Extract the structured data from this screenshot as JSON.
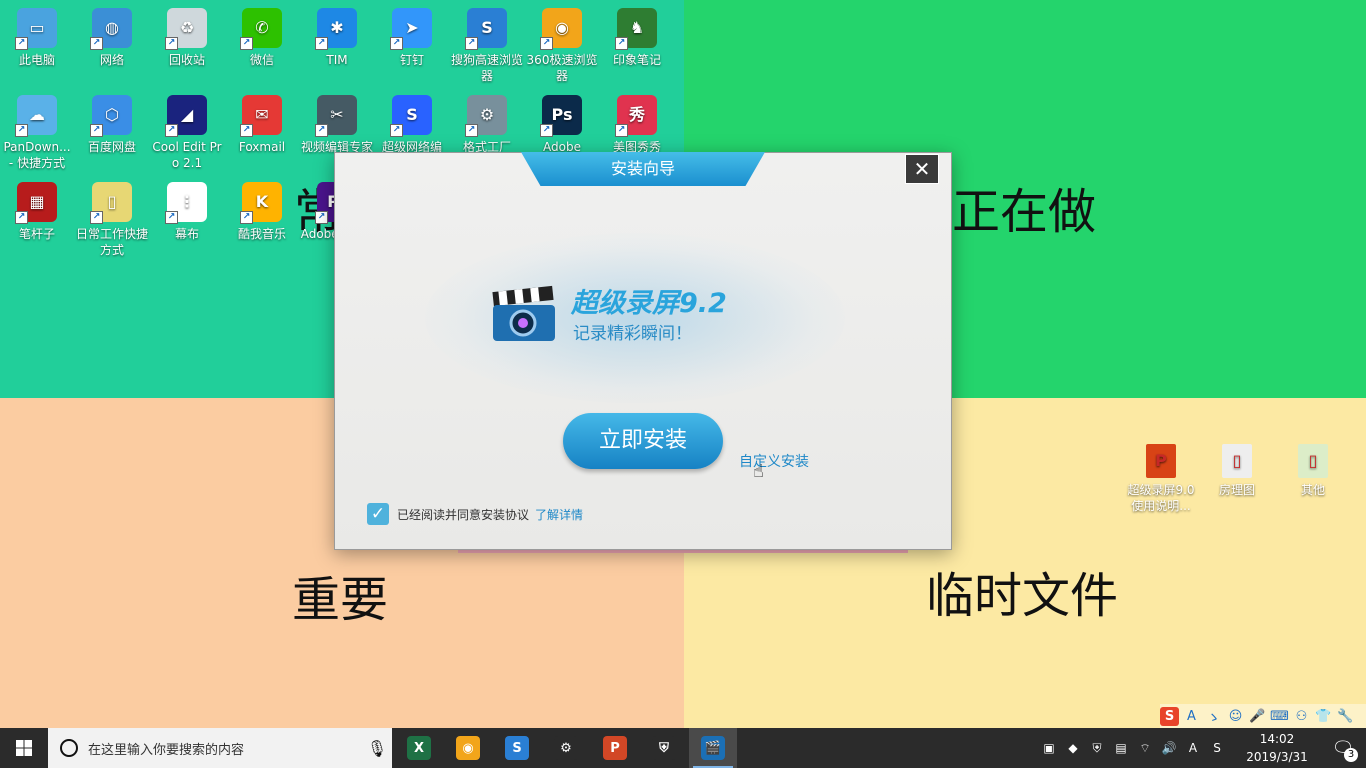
{
  "desktop": {
    "zones": {
      "top_left": "常",
      "top_right": "正在做",
      "bottom_left": "重要",
      "bottom_right": "临时文件"
    },
    "icons": [
      {
        "label": "此电脑",
        "color": "#4aa3df",
        "glyph": "▭"
      },
      {
        "label": "网络",
        "color": "#3b8fd6",
        "glyph": "◍"
      },
      {
        "label": "回收站",
        "color": "#cfd8dc",
        "glyph": "♻"
      },
      {
        "label": "微信",
        "color": "#2dc100",
        "glyph": "✆"
      },
      {
        "label": "TIM",
        "color": "#1e88e5",
        "glyph": "✱"
      },
      {
        "label": "钉钉",
        "color": "#3296fa",
        "glyph": "➤"
      },
      {
        "label": "搜狗高速浏览器",
        "color": "#2a7fd4",
        "glyph": "S"
      },
      {
        "label": "360极速浏览器",
        "color": "#f2a51a",
        "glyph": "◉"
      },
      {
        "label": "印象笔记",
        "color": "#2e7d32",
        "glyph": "♞"
      },
      {
        "label": "PanDown... - 快捷方式",
        "color": "#5ab1e8",
        "glyph": "☁"
      },
      {
        "label": "百度网盘",
        "color": "#3a8ee6",
        "glyph": "⬡"
      },
      {
        "label": "Cool Edit Pro 2.1",
        "color": "#1a237e",
        "glyph": "◢"
      },
      {
        "label": "Foxmail",
        "color": "#e53935",
        "glyph": "✉"
      },
      {
        "label": "视频编辑专家",
        "color": "#455a64",
        "glyph": "✂"
      },
      {
        "label": "超级网络编",
        "color": "#2962ff",
        "glyph": "S"
      },
      {
        "label": "格式工厂",
        "color": "#78909c",
        "glyph": "⚙"
      },
      {
        "label": "Adobe",
        "color": "#0b2a4a",
        "glyph": "Ps"
      },
      {
        "label": "美图秀秀",
        "color": "#e0334f",
        "glyph": "秀"
      },
      {
        "label": "笔杆子",
        "color": "#b71c1c",
        "glyph": "▦"
      },
      {
        "label": "日常工作快捷方式",
        "color": "#e7d774",
        "glyph": "▯"
      },
      {
        "label": "幕布",
        "color": "#ffffff",
        "glyph": "⋮"
      },
      {
        "label": "酷我音乐",
        "color": "#ffb300",
        "glyph": "K"
      },
      {
        "label": "Adobe Premi",
        "color": "#4a148c",
        "glyph": "Pr"
      }
    ],
    "file_icons": [
      {
        "label": "超级录屏9.0使用说明...",
        "color": "#d84315",
        "glyph": "P"
      },
      {
        "label": "房理图",
        "color": "#eeeeee",
        "glyph": "▯"
      },
      {
        "label": "其他",
        "color": "#dcedc8",
        "glyph": "▯"
      }
    ]
  },
  "dialog": {
    "title": "安装向导",
    "close_glyph": "✕",
    "brand_title": "超级录屏9.2",
    "brand_subtitle": "记录精彩瞬间！",
    "install_button": "立即安装",
    "custom_install": "自定义安装",
    "agreement_checked": true,
    "agreement_text": "已经阅读并同意安装协议",
    "details_link": "了解详情"
  },
  "ime_toolbar": [
    "S",
    "A",
    "ゝ",
    "☺",
    "🎤",
    "⌨",
    "⚇",
    "👕",
    "🔧"
  ],
  "taskbar": {
    "search_placeholder": "在这里输入你要搜索的内容",
    "apps": [
      {
        "name": "excel",
        "glyph": "X",
        "color": "#1e7145"
      },
      {
        "name": "360-browser",
        "glyph": "◉",
        "color": "#f2a51a"
      },
      {
        "name": "sogou-browser",
        "glyph": "S",
        "color": "#2a7fd4"
      },
      {
        "name": "settings",
        "glyph": "⚙",
        "color": "#2b2b2b"
      },
      {
        "name": "powerpoint",
        "glyph": "P",
        "color": "#d24726"
      },
      {
        "name": "security",
        "glyph": "⛨",
        "color": "#2b2b2b"
      },
      {
        "name": "screen-recorder",
        "glyph": "🎬",
        "color": "#1b6fb5"
      }
    ],
    "tray_icons": [
      "▣",
      "◆",
      "⛨",
      "▤",
      "⌔",
      "🔊",
      "A",
      "S"
    ],
    "time": "14:02",
    "date": "2019/3/31",
    "notification_count": "3"
  }
}
